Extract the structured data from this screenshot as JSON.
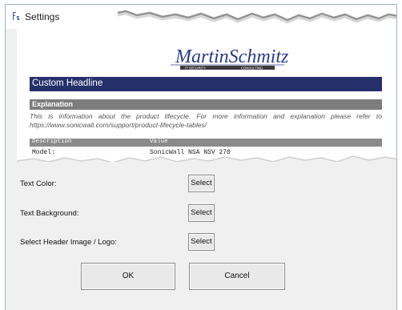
{
  "window": {
    "title": "Settings",
    "icon": "settings-window-icon"
  },
  "preview": {
    "logo_text": "MartinSchmitz",
    "logo_subtext_left": "IT SECURITY",
    "logo_subtext_right": "CONSULTING",
    "headline": "Custom Headline",
    "explanation_header": "Explanation",
    "explanation_text": "This is information about the product lifecycle. For more information and explanation please refer to https://www.sonicwall.com/support/product-lifecycle-tables/",
    "table": {
      "columns": [
        "Description",
        "Value"
      ],
      "rows": [
        [
          "Model:",
          "SonicWall NSA NSV 270"
        ]
      ]
    },
    "colors": {
      "headline_bg": "#25306b",
      "section_bg": "#7d7d7d"
    }
  },
  "form": {
    "text_color_label": "Text Color:",
    "text_background_label": "Text Background:",
    "header_image_label": "Select Header Image / Logo:",
    "select_label": "Select"
  },
  "buttons": {
    "ok": "OK",
    "cancel": "Cancel"
  }
}
